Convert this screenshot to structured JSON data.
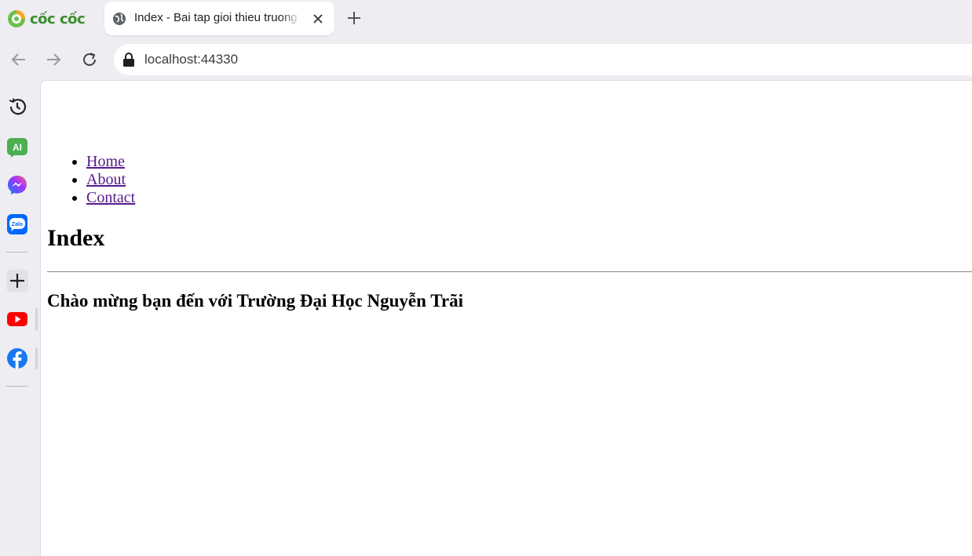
{
  "browser": {
    "brand_name": "cốc cốc",
    "tab": {
      "title": "Index - Bai tap gioi thieu truong"
    },
    "address": {
      "url": "localhost:44330"
    }
  },
  "sidebar": {
    "items": [
      {
        "name": "history-icon"
      },
      {
        "name": "ai-icon",
        "label": "AI"
      },
      {
        "name": "messenger-icon"
      },
      {
        "name": "zalo-icon",
        "label": "Zalo"
      },
      {
        "name": "add-icon"
      },
      {
        "name": "youtube-icon"
      },
      {
        "name": "facebook-icon"
      }
    ]
  },
  "page": {
    "nav": [
      {
        "label": "Home"
      },
      {
        "label": "About"
      },
      {
        "label": "Contact"
      }
    ],
    "title": "Index",
    "welcome": "Chào mừng bạn đến với Trường Đại Học Nguyễn Trãi"
  },
  "colors": {
    "chrome_bg": "#eeeef2",
    "link_visited": "#551a8b",
    "brand_green": "#3c8d2f",
    "youtube_red": "#ff0000",
    "facebook_blue": "#1877f2",
    "zalo_blue": "#0068ff"
  }
}
